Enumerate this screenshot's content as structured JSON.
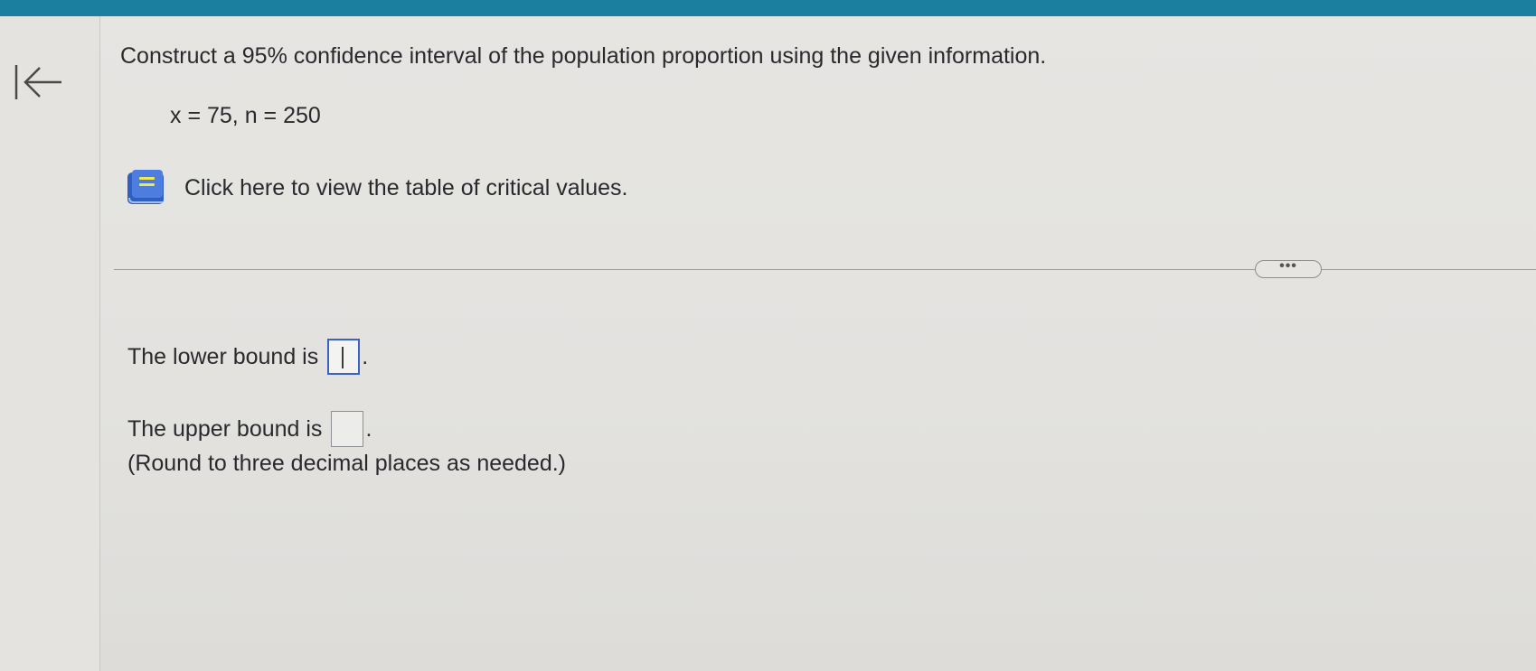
{
  "colors": {
    "top_bar": "#1b7f9f",
    "active_input_border": "#3a62c4",
    "book_icon": "#2f5fc0"
  },
  "nav": {
    "back_icon": "arrow-left-to-bar-icon"
  },
  "question": {
    "prompt": "Construct a 95% confidence interval of the population proportion using the given information.",
    "given": "x = 75, n = 250"
  },
  "resource_link": {
    "icon": "book-icon",
    "label": "Click here to view the table of critical values."
  },
  "more_button": {
    "icon": "ellipsis-icon",
    "label": "•••"
  },
  "answers": {
    "lower_label": "The lower bound is",
    "lower_value": "",
    "upper_label": "The upper bound is",
    "upper_value": "",
    "terminator": ".",
    "note": "(Round to three decimal places as needed.)"
  }
}
